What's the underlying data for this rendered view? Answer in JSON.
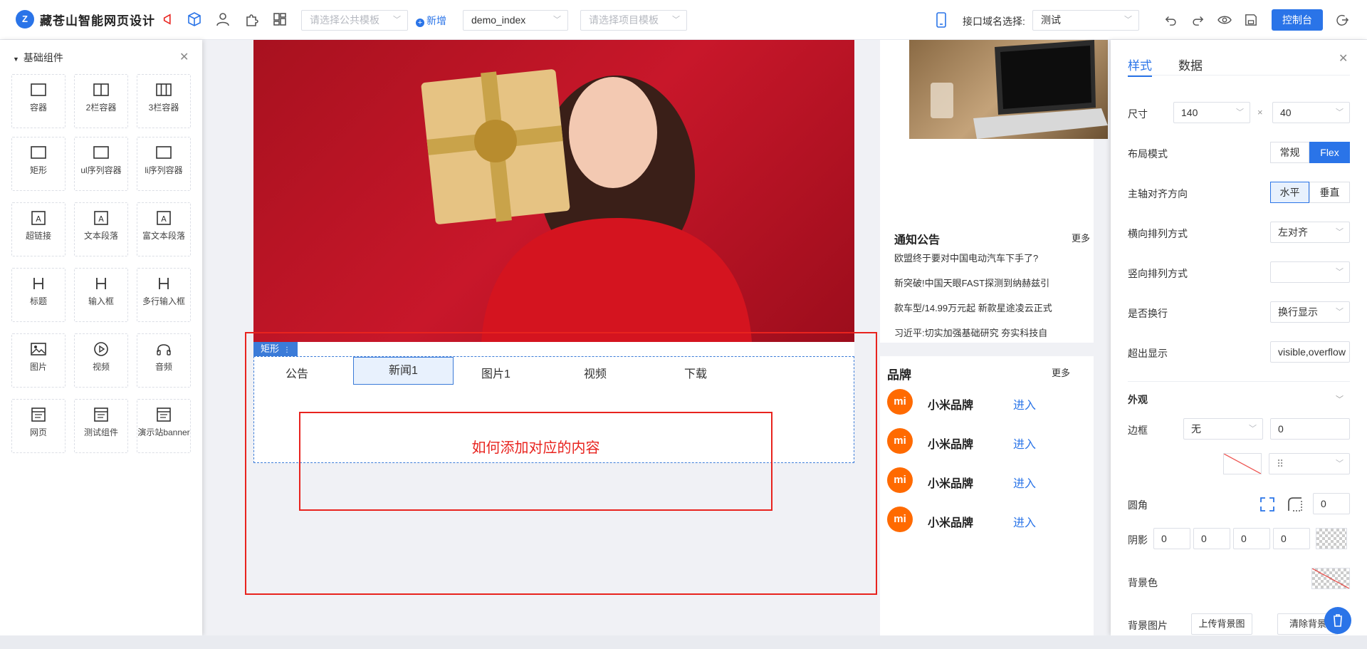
{
  "header": {
    "logo_text": "Z",
    "brand": "藏苍山智能网页设计",
    "public_template_placeholder": "请选择公共模板",
    "add_label": "新增",
    "page_select": "demo_index",
    "project_template_placeholder": "请选择项目模板",
    "domain_label": "接口域名选择:",
    "domain_value": "测试",
    "console_label": "控制台"
  },
  "left_panel": {
    "title": "基础组件",
    "components": [
      {
        "label": "容器",
        "icon": "container-icon"
      },
      {
        "label": "2栏容器",
        "icon": "two-column-icon"
      },
      {
        "label": "3栏容器",
        "icon": "three-column-icon"
      },
      {
        "label": "矩形",
        "icon": "rectangle-icon"
      },
      {
        "label": "ul序列容器",
        "icon": "ul-list-icon"
      },
      {
        "label": "li序列容器",
        "icon": "li-list-icon"
      },
      {
        "label": "超链接",
        "icon": "hyperlink-icon"
      },
      {
        "label": "文本段落",
        "icon": "text-paragraph-icon"
      },
      {
        "label": "富文本段落",
        "icon": "rich-text-icon"
      },
      {
        "label": "标题",
        "icon": "heading-icon"
      },
      {
        "label": "输入框",
        "icon": "input-icon"
      },
      {
        "label": "多行输入框",
        "icon": "textarea-icon"
      },
      {
        "label": "图片",
        "icon": "image-icon"
      },
      {
        "label": "视频",
        "icon": "video-icon"
      },
      {
        "label": "音频",
        "icon": "audio-icon"
      },
      {
        "label": "网页",
        "icon": "webpage-icon"
      },
      {
        "label": "测试组件",
        "icon": "test-component-icon"
      },
      {
        "label": "演示站banner",
        "icon": "banner-icon"
      }
    ]
  },
  "canvas": {
    "selected_tag": "矩形",
    "tabs": [
      "公告",
      "新闻1",
      "图片1",
      "视频",
      "下载"
    ],
    "active_tab": "新闻1",
    "annotation": "如何添加对应的内容"
  },
  "notice": {
    "title": "通知公告",
    "more": "更多",
    "items": [
      "欧盟终于要对中国电动汽车下手了?",
      "新突破!中国天眼FAST探测到纳赫兹引",
      "款车型/14.99万元起 新款星途凌云正式",
      "习近平:切实加强基础研究 夯实科技自"
    ]
  },
  "brands": {
    "title": "品牌",
    "more": "更多",
    "logo_text": "mi",
    "items": [
      {
        "name": "小米品牌",
        "action": "进入"
      },
      {
        "name": "小米品牌",
        "action": "进入"
      },
      {
        "name": "小米品牌",
        "action": "进入"
      },
      {
        "name": "小米品牌",
        "action": "进入"
      }
    ]
  },
  "props": {
    "tabs": [
      "样式",
      "数据"
    ],
    "size_label": "尺寸",
    "width": "140",
    "times": "×",
    "height": "40",
    "layout_label": "布局模式",
    "layout_options": [
      "常规",
      "Flex"
    ],
    "main_axis_label": "主轴对齐方向",
    "main_axis_options": [
      "水平",
      "垂直"
    ],
    "h_arrange_label": "横向排列方式",
    "h_arrange_value": "左对齐",
    "v_arrange_label": "竖向排列方式",
    "v_arrange_value": "",
    "wrap_label": "是否换行",
    "wrap_value": "换行显示",
    "overflow_label": "超出显示",
    "overflow_value": "visible,overflow",
    "appearance_label": "外观",
    "border_label": "边框",
    "border_style": "无",
    "border_width": "0",
    "radius_label": "圆角",
    "radius_value": "0",
    "shadow_label": "阴影",
    "shadow_values": [
      "0",
      "0",
      "0",
      "0"
    ],
    "bg_color_label": "背景色",
    "bg_image_label": "背景图片",
    "upload_bg": "上传背景图",
    "clear_bg": "清除背景"
  },
  "colors": {
    "accent": "#2a74e8",
    "annotation_red": "#e8231e",
    "brand_orange": "#ff6a00"
  }
}
